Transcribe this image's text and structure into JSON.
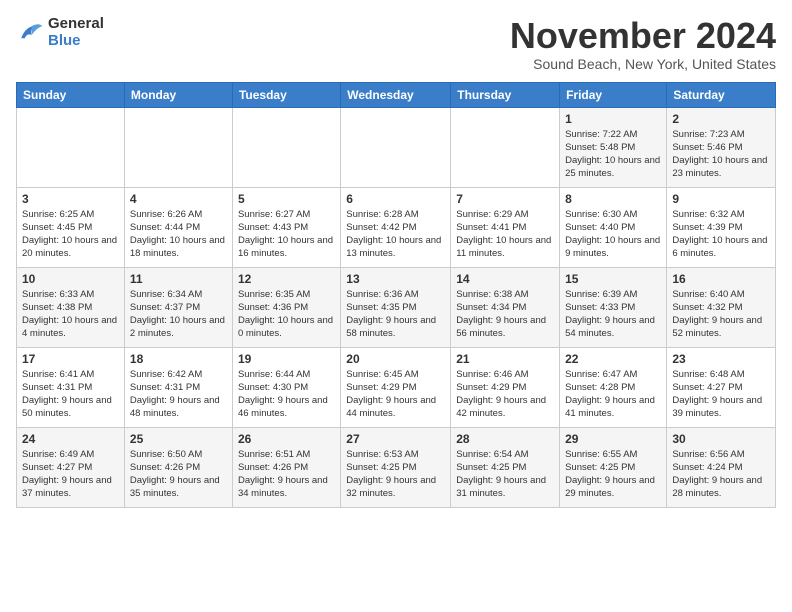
{
  "header": {
    "logo": {
      "general": "General",
      "blue": "Blue"
    },
    "month": "November 2024",
    "location": "Sound Beach, New York, United States"
  },
  "weekdays": [
    "Sunday",
    "Monday",
    "Tuesday",
    "Wednesday",
    "Thursday",
    "Friday",
    "Saturday"
  ],
  "weeks": [
    [
      {
        "day": "",
        "info": ""
      },
      {
        "day": "",
        "info": ""
      },
      {
        "day": "",
        "info": ""
      },
      {
        "day": "",
        "info": ""
      },
      {
        "day": "",
        "info": ""
      },
      {
        "day": "1",
        "info": "Sunrise: 7:22 AM\nSunset: 5:48 PM\nDaylight: 10 hours and 25 minutes."
      },
      {
        "day": "2",
        "info": "Sunrise: 7:23 AM\nSunset: 5:46 PM\nDaylight: 10 hours and 23 minutes."
      }
    ],
    [
      {
        "day": "3",
        "info": "Sunrise: 6:25 AM\nSunset: 4:45 PM\nDaylight: 10 hours and 20 minutes."
      },
      {
        "day": "4",
        "info": "Sunrise: 6:26 AM\nSunset: 4:44 PM\nDaylight: 10 hours and 18 minutes."
      },
      {
        "day": "5",
        "info": "Sunrise: 6:27 AM\nSunset: 4:43 PM\nDaylight: 10 hours and 16 minutes."
      },
      {
        "day": "6",
        "info": "Sunrise: 6:28 AM\nSunset: 4:42 PM\nDaylight: 10 hours and 13 minutes."
      },
      {
        "day": "7",
        "info": "Sunrise: 6:29 AM\nSunset: 4:41 PM\nDaylight: 10 hours and 11 minutes."
      },
      {
        "day": "8",
        "info": "Sunrise: 6:30 AM\nSunset: 4:40 PM\nDaylight: 10 hours and 9 minutes."
      },
      {
        "day": "9",
        "info": "Sunrise: 6:32 AM\nSunset: 4:39 PM\nDaylight: 10 hours and 6 minutes."
      }
    ],
    [
      {
        "day": "10",
        "info": "Sunrise: 6:33 AM\nSunset: 4:38 PM\nDaylight: 10 hours and 4 minutes."
      },
      {
        "day": "11",
        "info": "Sunrise: 6:34 AM\nSunset: 4:37 PM\nDaylight: 10 hours and 2 minutes."
      },
      {
        "day": "12",
        "info": "Sunrise: 6:35 AM\nSunset: 4:36 PM\nDaylight: 10 hours and 0 minutes."
      },
      {
        "day": "13",
        "info": "Sunrise: 6:36 AM\nSunset: 4:35 PM\nDaylight: 9 hours and 58 minutes."
      },
      {
        "day": "14",
        "info": "Sunrise: 6:38 AM\nSunset: 4:34 PM\nDaylight: 9 hours and 56 minutes."
      },
      {
        "day": "15",
        "info": "Sunrise: 6:39 AM\nSunset: 4:33 PM\nDaylight: 9 hours and 54 minutes."
      },
      {
        "day": "16",
        "info": "Sunrise: 6:40 AM\nSunset: 4:32 PM\nDaylight: 9 hours and 52 minutes."
      }
    ],
    [
      {
        "day": "17",
        "info": "Sunrise: 6:41 AM\nSunset: 4:31 PM\nDaylight: 9 hours and 50 minutes."
      },
      {
        "day": "18",
        "info": "Sunrise: 6:42 AM\nSunset: 4:31 PM\nDaylight: 9 hours and 48 minutes."
      },
      {
        "day": "19",
        "info": "Sunrise: 6:44 AM\nSunset: 4:30 PM\nDaylight: 9 hours and 46 minutes."
      },
      {
        "day": "20",
        "info": "Sunrise: 6:45 AM\nSunset: 4:29 PM\nDaylight: 9 hours and 44 minutes."
      },
      {
        "day": "21",
        "info": "Sunrise: 6:46 AM\nSunset: 4:29 PM\nDaylight: 9 hours and 42 minutes."
      },
      {
        "day": "22",
        "info": "Sunrise: 6:47 AM\nSunset: 4:28 PM\nDaylight: 9 hours and 41 minutes."
      },
      {
        "day": "23",
        "info": "Sunrise: 6:48 AM\nSunset: 4:27 PM\nDaylight: 9 hours and 39 minutes."
      }
    ],
    [
      {
        "day": "24",
        "info": "Sunrise: 6:49 AM\nSunset: 4:27 PM\nDaylight: 9 hours and 37 minutes."
      },
      {
        "day": "25",
        "info": "Sunrise: 6:50 AM\nSunset: 4:26 PM\nDaylight: 9 hours and 35 minutes."
      },
      {
        "day": "26",
        "info": "Sunrise: 6:51 AM\nSunset: 4:26 PM\nDaylight: 9 hours and 34 minutes."
      },
      {
        "day": "27",
        "info": "Sunrise: 6:53 AM\nSunset: 4:25 PM\nDaylight: 9 hours and 32 minutes."
      },
      {
        "day": "28",
        "info": "Sunrise: 6:54 AM\nSunset: 4:25 PM\nDaylight: 9 hours and 31 minutes."
      },
      {
        "day": "29",
        "info": "Sunrise: 6:55 AM\nSunset: 4:25 PM\nDaylight: 9 hours and 29 minutes."
      },
      {
        "day": "30",
        "info": "Sunrise: 6:56 AM\nSunset: 4:24 PM\nDaylight: 9 hours and 28 minutes."
      }
    ]
  ]
}
